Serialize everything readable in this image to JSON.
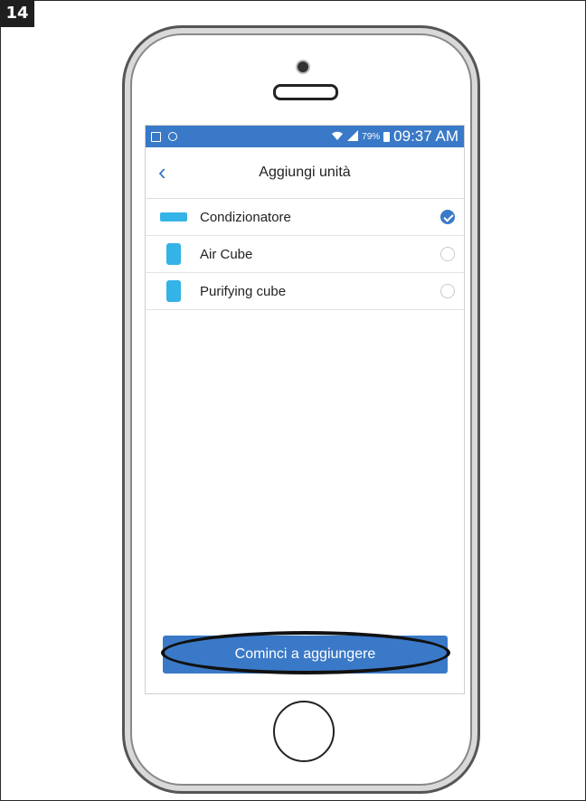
{
  "step_badge": "14",
  "status": {
    "battery_pct": "79%",
    "time": "09:37 AM"
  },
  "header": {
    "title": "Aggiungi unità"
  },
  "units": [
    {
      "label": "Condizionatore",
      "icon": "air-conditioner-icon",
      "selected": true
    },
    {
      "label": "Air Cube",
      "icon": "air-cube-icon",
      "selected": false
    },
    {
      "label": "Purifying cube",
      "icon": "purifier-cube-icon",
      "selected": false
    }
  ],
  "cta": {
    "label": "Cominci a aggiungere"
  },
  "colors": {
    "accent": "#3a79c7",
    "icon_blue": "#34b3e6"
  }
}
